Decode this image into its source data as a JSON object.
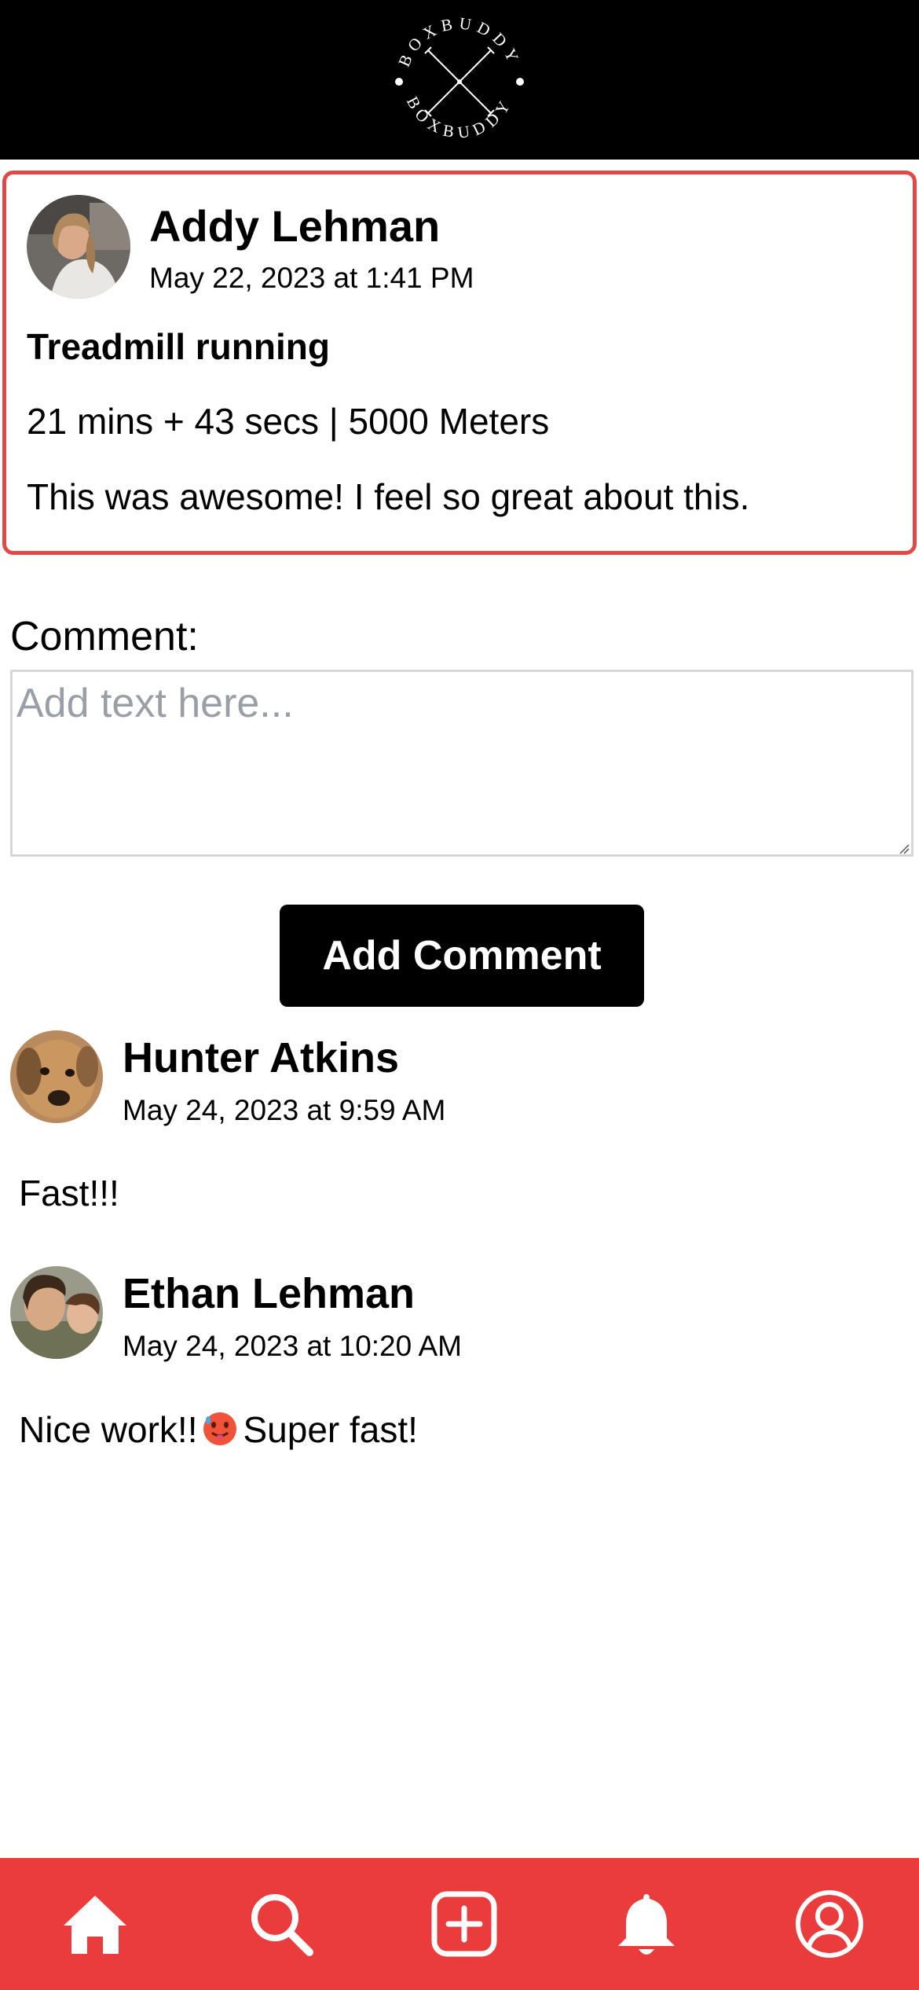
{
  "header": {
    "logo_text": "BOXBUDDY"
  },
  "post": {
    "author": "Addy Lehman",
    "date": "May 22, 2023 at 1:41 PM",
    "title": "Treadmill running",
    "stats": "21 mins + 43 secs | 5000 Meters",
    "text": "This was awesome! I feel so great about this."
  },
  "comment_form": {
    "label": "Comment:",
    "placeholder": "Add text here...",
    "value": "",
    "button_label": "Add Comment"
  },
  "comments": [
    {
      "author": "Hunter Atkins",
      "date": "May 24, 2023 at 9:59 AM",
      "text": "Fast!!!"
    },
    {
      "author": "Ethan Lehman",
      "date": "May 24, 2023 at 10:20 AM",
      "text_before_emoji": "Nice work!!",
      "emoji": "hot-face",
      "text_after_emoji": "Super fast!"
    }
  ],
  "bottom_nav": {
    "items": [
      "home-icon",
      "search-icon",
      "add-square-icon",
      "bell-icon",
      "profile-icon"
    ],
    "background": "#ea3c3c"
  },
  "colors": {
    "accent": "#e34848",
    "header": "#000000",
    "button": "#000000"
  }
}
